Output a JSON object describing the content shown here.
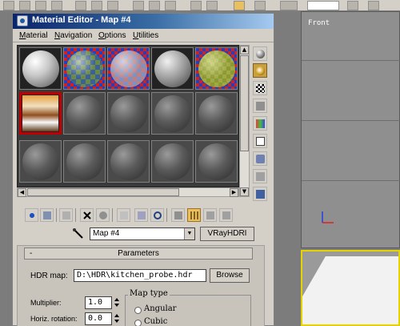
{
  "window": {
    "title": "Material Editor - Map #4"
  },
  "menu": [
    {
      "label": "Material",
      "ul": "M",
      "rest": "aterial"
    },
    {
      "label": "Navigation",
      "ul": "N",
      "rest": "avigation"
    },
    {
      "label": "Options",
      "ul": "O",
      "rest": "ptions"
    },
    {
      "label": "Utilities",
      "ul": "U",
      "rest": "tilities"
    }
  ],
  "viewport": {
    "front_label": "Front"
  },
  "sample_slots": [
    {
      "kind": "white"
    },
    {
      "kind": "checker"
    },
    {
      "kind": "pastel"
    },
    {
      "kind": "room"
    },
    {
      "kind": "green"
    },
    {
      "kind": "hdr",
      "selected": true
    },
    {
      "kind": "default"
    },
    {
      "kind": "default"
    },
    {
      "kind": "default"
    },
    {
      "kind": "default"
    },
    {
      "kind": "default"
    },
    {
      "kind": "default"
    },
    {
      "kind": "default"
    },
    {
      "kind": "default"
    },
    {
      "kind": "default"
    }
  ],
  "map": {
    "name": "Map #4",
    "type_button": "VRayHDRI"
  },
  "parameters": {
    "rollout_title": "Parameters",
    "collapse_symbol": "-",
    "hdr_map_label": "HDR map:",
    "hdr_map_value": "D:\\HDR\\kitchen_probe.hdr",
    "browse_label": "Browse",
    "multiplier_label": "Multiplier:",
    "multiplier_value": "1.0",
    "horiz_rotation_label": "Horiz. rotation:",
    "horiz_rotation_value": "0.0",
    "map_type_title": "Map type",
    "map_types": [
      "Angular",
      "Cubic"
    ]
  },
  "colors": {
    "selected_border": "#c00000",
    "title_gradient_start": "#0a246a",
    "active_button": "#e8c060"
  }
}
